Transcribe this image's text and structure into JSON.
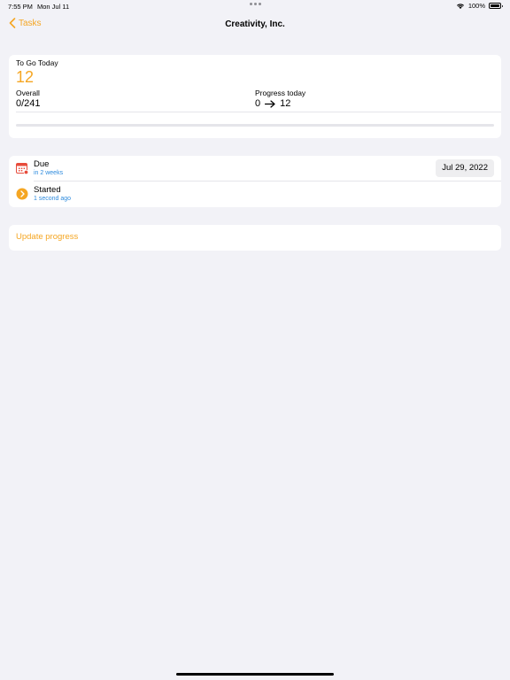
{
  "status_bar": {
    "time": "7:55 PM",
    "date": "Mon Jul 11",
    "battery": "100%"
  },
  "nav": {
    "back_label": "Tasks",
    "title": "Creativity, Inc."
  },
  "summary": {
    "to_go_label": "To Go Today",
    "to_go_value": "12",
    "overall_label": "Overall",
    "overall_value": "0/241",
    "progress_label": "Progress today",
    "progress_from": "0",
    "progress_to": "12",
    "progress_fraction": 0
  },
  "schedule": {
    "due_label": "Due",
    "due_relative": "in 2 weeks",
    "due_date": "Jul 29, 2022",
    "started_label": "Started",
    "started_relative": "1 second ago"
  },
  "actions": {
    "update_progress": "Update progress"
  },
  "colors": {
    "accent": "#f5a623",
    "link_blue": "#2e8bdd",
    "background": "#f2f2f7",
    "due_icon": "#e74c3c"
  },
  "icons": {
    "back": "chevron-left-icon",
    "due": "calendar-icon",
    "started": "chevron-right-circle-icon",
    "wifi": "wifi-icon",
    "battery": "battery-icon"
  }
}
